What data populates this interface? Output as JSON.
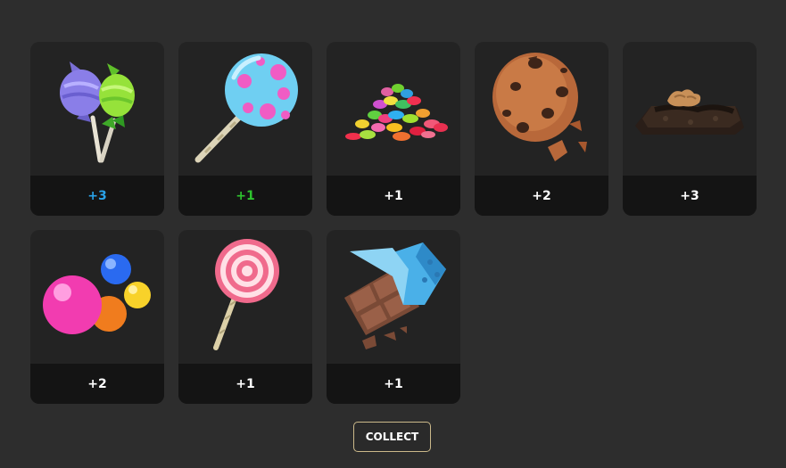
{
  "colors": {
    "background": "#2d2d2d",
    "card": "#232323",
    "card_footer": "#141414",
    "rare_blue": "#2aa3ea",
    "uncommon_green": "#2ec42e",
    "common_white": "#ffffff",
    "button_border": "#cbb98a"
  },
  "rewards": [
    {
      "item": "wrapped-candy-lollipops-icon",
      "count": "+3",
      "count_color": "#2aa3ea"
    },
    {
      "item": "blue-lollipop-icon",
      "count": "+1",
      "count_color": "#2ec42e"
    },
    {
      "item": "jelly-beans-icon",
      "count": "+1",
      "count_color": "#ffffff"
    },
    {
      "item": "cookie-icon",
      "count": "+2",
      "count_color": "#ffffff"
    },
    {
      "item": "brownie-icon",
      "count": "+3",
      "count_color": "#ffffff"
    },
    {
      "item": "gumballs-icon",
      "count": "+2",
      "count_color": "#ffffff"
    },
    {
      "item": "swirl-lollipop-icon",
      "count": "+1",
      "count_color": "#ffffff"
    },
    {
      "item": "chocolate-bar-icon",
      "count": "+1",
      "count_color": "#ffffff"
    }
  ],
  "collect_button": {
    "label": "COLLECT"
  }
}
